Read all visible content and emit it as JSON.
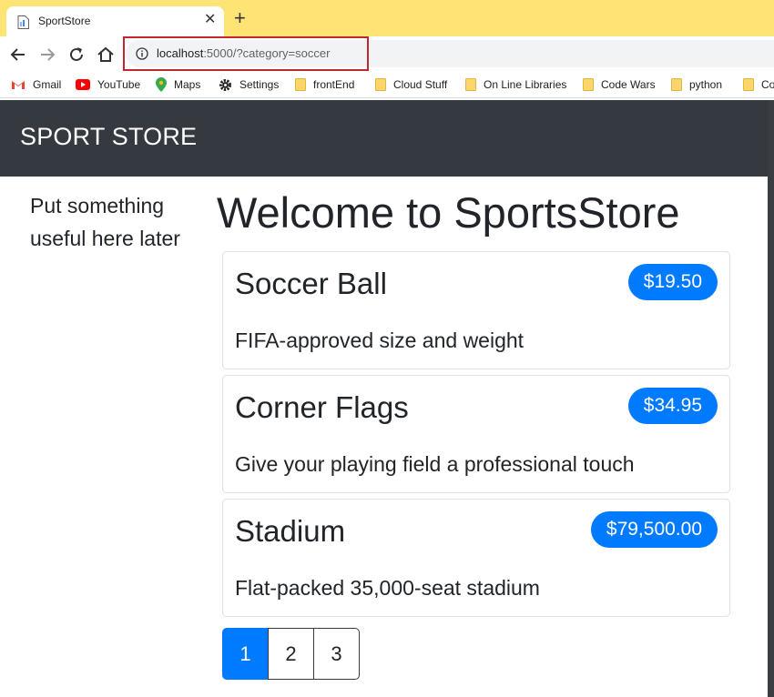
{
  "browser": {
    "tab_title": "SportStore",
    "tab_close": "✕",
    "new_tab": "+",
    "url_host": "localhost",
    "url_path": ":5000/?category=soccer",
    "bookmarks": [
      {
        "label": "Gmail",
        "icon": "gmail-icon"
      },
      {
        "label": "YouTube",
        "icon": "youtube-icon"
      },
      {
        "label": "Maps",
        "icon": "maps-icon"
      },
      {
        "label": "Settings",
        "icon": "gear-icon"
      },
      {
        "label": "frontEnd",
        "icon": "folder-icon"
      },
      {
        "label": "Cloud Stuff",
        "icon": "folder-icon"
      },
      {
        "label": "On Line Libraries",
        "icon": "folder-icon"
      },
      {
        "label": "Code Wars",
        "icon": "folder-icon"
      },
      {
        "label": "python",
        "icon": "folder-icon"
      },
      {
        "label": "Co",
        "icon": "folder-icon"
      }
    ]
  },
  "navbar": {
    "brand": "SPORT STORE",
    "color": "#343a40"
  },
  "sidebar": {
    "text": "Put something useful here later"
  },
  "main": {
    "heading": "Welcome to SportsStore",
    "products": [
      {
        "name": "Soccer Ball",
        "price": "$19.50",
        "description": "FIFA-approved size and weight"
      },
      {
        "name": "Corner Flags",
        "price": "$34.95",
        "description": "Give your playing field a professional touch"
      },
      {
        "name": "Stadium",
        "price": "$79,500.00",
        "description": "Flat-packed 35,000-seat stadium"
      }
    ],
    "pagination": [
      {
        "label": "1",
        "active": true
      },
      {
        "label": "2",
        "active": false
      },
      {
        "label": "3",
        "active": false
      }
    ]
  },
  "colors": {
    "accent": "#007bff",
    "tabstrip": "#fde475",
    "highlight": "#c0282d"
  }
}
